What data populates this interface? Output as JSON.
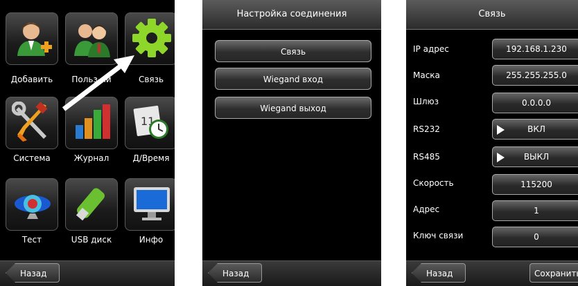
{
  "screen1": {
    "tiles": [
      {
        "label": "Добавить",
        "icon": "add-user-icon"
      },
      {
        "label": "Польз-ли",
        "icon": "users-icon"
      },
      {
        "label": "Связь",
        "icon": "gear-icon"
      },
      {
        "label": "Система",
        "icon": "tools-icon"
      },
      {
        "label": "Журнал",
        "icon": "bar-chart-icon"
      },
      {
        "label": "Д/Время",
        "icon": "calendar-clock-icon"
      },
      {
        "label": "Тест",
        "icon": "test-icon"
      },
      {
        "label": "USB диск",
        "icon": "usb-drive-icon"
      },
      {
        "label": "Инфо",
        "icon": "monitor-icon"
      }
    ],
    "back_label": "Назад"
  },
  "screen2": {
    "title": "Настройка соединения",
    "items": [
      "Связь",
      "Wiegand вход",
      "Wiegand выход"
    ],
    "back_label": "Назад"
  },
  "screen3": {
    "title": "Связь",
    "rows": [
      {
        "label": "IP адрес",
        "value": "192.168.1.230"
      },
      {
        "label": "Маска",
        "value": "255.255.255.0"
      },
      {
        "label": "Шлюз",
        "value": "0.0.0.0"
      },
      {
        "label": "RS232",
        "value": "ВКЛ"
      },
      {
        "label": "RS485",
        "value": "ВЫКЛ"
      },
      {
        "label": "Скорость",
        "value": "115200"
      },
      {
        "label": "Адрес",
        "value": "1"
      },
      {
        "label": "Ключ связи",
        "value": "0"
      }
    ],
    "back_label": "Назад",
    "save_label": "Сохранить"
  },
  "colors": {
    "background": "#000000",
    "bar": "#2b2b2b",
    "button_border": "#aaaaaa",
    "arrow": "#ffffff"
  }
}
